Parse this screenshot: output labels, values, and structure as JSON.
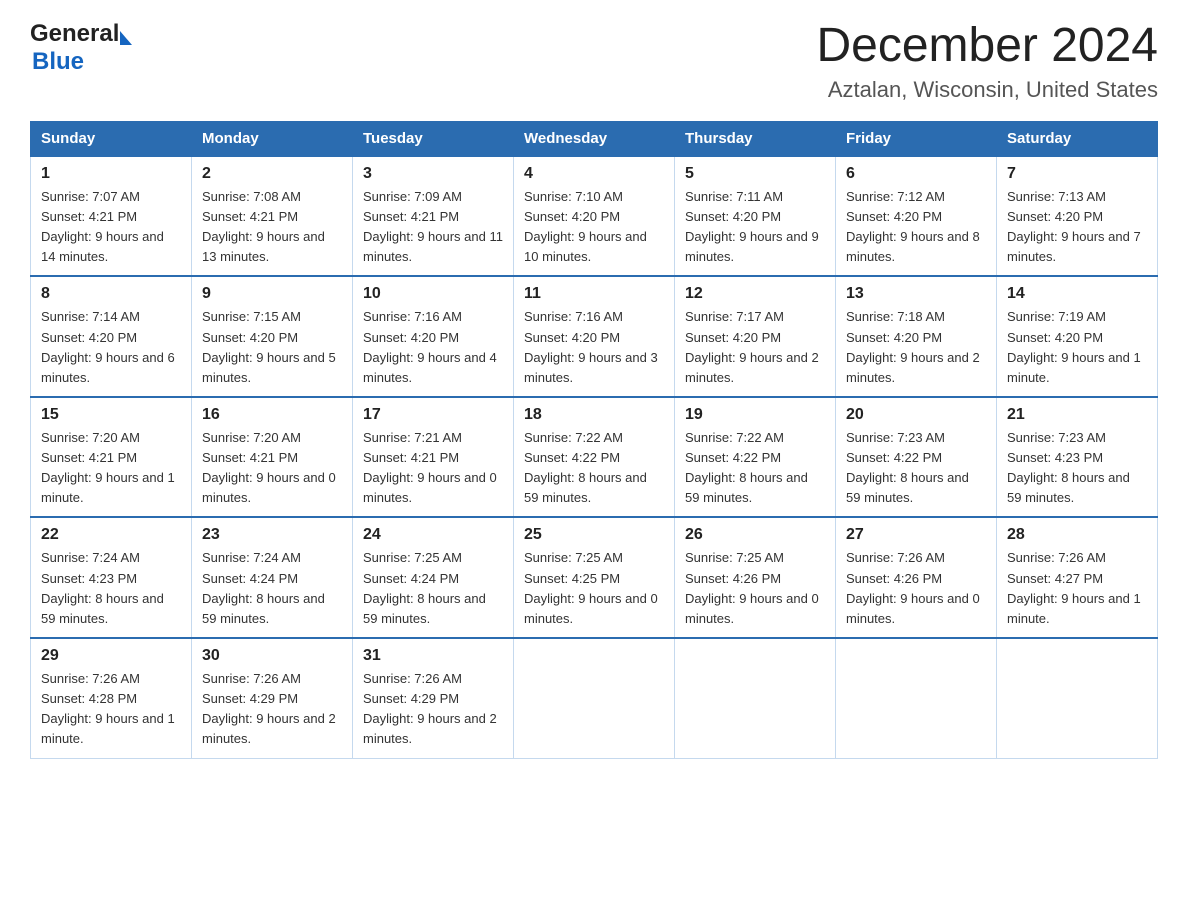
{
  "header": {
    "logo_general": "General",
    "logo_blue": "Blue",
    "month_title": "December 2024",
    "location": "Aztalan, Wisconsin, United States"
  },
  "weekdays": [
    "Sunday",
    "Monday",
    "Tuesday",
    "Wednesday",
    "Thursday",
    "Friday",
    "Saturday"
  ],
  "weeks": [
    [
      {
        "day": "1",
        "sunrise": "7:07 AM",
        "sunset": "4:21 PM",
        "daylight": "9 hours and 14 minutes."
      },
      {
        "day": "2",
        "sunrise": "7:08 AM",
        "sunset": "4:21 PM",
        "daylight": "9 hours and 13 minutes."
      },
      {
        "day": "3",
        "sunrise": "7:09 AM",
        "sunset": "4:21 PM",
        "daylight": "9 hours and 11 minutes."
      },
      {
        "day": "4",
        "sunrise": "7:10 AM",
        "sunset": "4:20 PM",
        "daylight": "9 hours and 10 minutes."
      },
      {
        "day": "5",
        "sunrise": "7:11 AM",
        "sunset": "4:20 PM",
        "daylight": "9 hours and 9 minutes."
      },
      {
        "day": "6",
        "sunrise": "7:12 AM",
        "sunset": "4:20 PM",
        "daylight": "9 hours and 8 minutes."
      },
      {
        "day": "7",
        "sunrise": "7:13 AM",
        "sunset": "4:20 PM",
        "daylight": "9 hours and 7 minutes."
      }
    ],
    [
      {
        "day": "8",
        "sunrise": "7:14 AM",
        "sunset": "4:20 PM",
        "daylight": "9 hours and 6 minutes."
      },
      {
        "day": "9",
        "sunrise": "7:15 AM",
        "sunset": "4:20 PM",
        "daylight": "9 hours and 5 minutes."
      },
      {
        "day": "10",
        "sunrise": "7:16 AM",
        "sunset": "4:20 PM",
        "daylight": "9 hours and 4 minutes."
      },
      {
        "day": "11",
        "sunrise": "7:16 AM",
        "sunset": "4:20 PM",
        "daylight": "9 hours and 3 minutes."
      },
      {
        "day": "12",
        "sunrise": "7:17 AM",
        "sunset": "4:20 PM",
        "daylight": "9 hours and 2 minutes."
      },
      {
        "day": "13",
        "sunrise": "7:18 AM",
        "sunset": "4:20 PM",
        "daylight": "9 hours and 2 minutes."
      },
      {
        "day": "14",
        "sunrise": "7:19 AM",
        "sunset": "4:20 PM",
        "daylight": "9 hours and 1 minute."
      }
    ],
    [
      {
        "day": "15",
        "sunrise": "7:20 AM",
        "sunset": "4:21 PM",
        "daylight": "9 hours and 1 minute."
      },
      {
        "day": "16",
        "sunrise": "7:20 AM",
        "sunset": "4:21 PM",
        "daylight": "9 hours and 0 minutes."
      },
      {
        "day": "17",
        "sunrise": "7:21 AM",
        "sunset": "4:21 PM",
        "daylight": "9 hours and 0 minutes."
      },
      {
        "day": "18",
        "sunrise": "7:22 AM",
        "sunset": "4:22 PM",
        "daylight": "8 hours and 59 minutes."
      },
      {
        "day": "19",
        "sunrise": "7:22 AM",
        "sunset": "4:22 PM",
        "daylight": "8 hours and 59 minutes."
      },
      {
        "day": "20",
        "sunrise": "7:23 AM",
        "sunset": "4:22 PM",
        "daylight": "8 hours and 59 minutes."
      },
      {
        "day": "21",
        "sunrise": "7:23 AM",
        "sunset": "4:23 PM",
        "daylight": "8 hours and 59 minutes."
      }
    ],
    [
      {
        "day": "22",
        "sunrise": "7:24 AM",
        "sunset": "4:23 PM",
        "daylight": "8 hours and 59 minutes."
      },
      {
        "day": "23",
        "sunrise": "7:24 AM",
        "sunset": "4:24 PM",
        "daylight": "8 hours and 59 minutes."
      },
      {
        "day": "24",
        "sunrise": "7:25 AM",
        "sunset": "4:24 PM",
        "daylight": "8 hours and 59 minutes."
      },
      {
        "day": "25",
        "sunrise": "7:25 AM",
        "sunset": "4:25 PM",
        "daylight": "9 hours and 0 minutes."
      },
      {
        "day": "26",
        "sunrise": "7:25 AM",
        "sunset": "4:26 PM",
        "daylight": "9 hours and 0 minutes."
      },
      {
        "day": "27",
        "sunrise": "7:26 AM",
        "sunset": "4:26 PM",
        "daylight": "9 hours and 0 minutes."
      },
      {
        "day": "28",
        "sunrise": "7:26 AM",
        "sunset": "4:27 PM",
        "daylight": "9 hours and 1 minute."
      }
    ],
    [
      {
        "day": "29",
        "sunrise": "7:26 AM",
        "sunset": "4:28 PM",
        "daylight": "9 hours and 1 minute."
      },
      {
        "day": "30",
        "sunrise": "7:26 AM",
        "sunset": "4:29 PM",
        "daylight": "9 hours and 2 minutes."
      },
      {
        "day": "31",
        "sunrise": "7:26 AM",
        "sunset": "4:29 PM",
        "daylight": "9 hours and 2 minutes."
      },
      null,
      null,
      null,
      null
    ]
  ],
  "labels": {
    "sunrise": "Sunrise:",
    "sunset": "Sunset:",
    "daylight": "Daylight:"
  }
}
